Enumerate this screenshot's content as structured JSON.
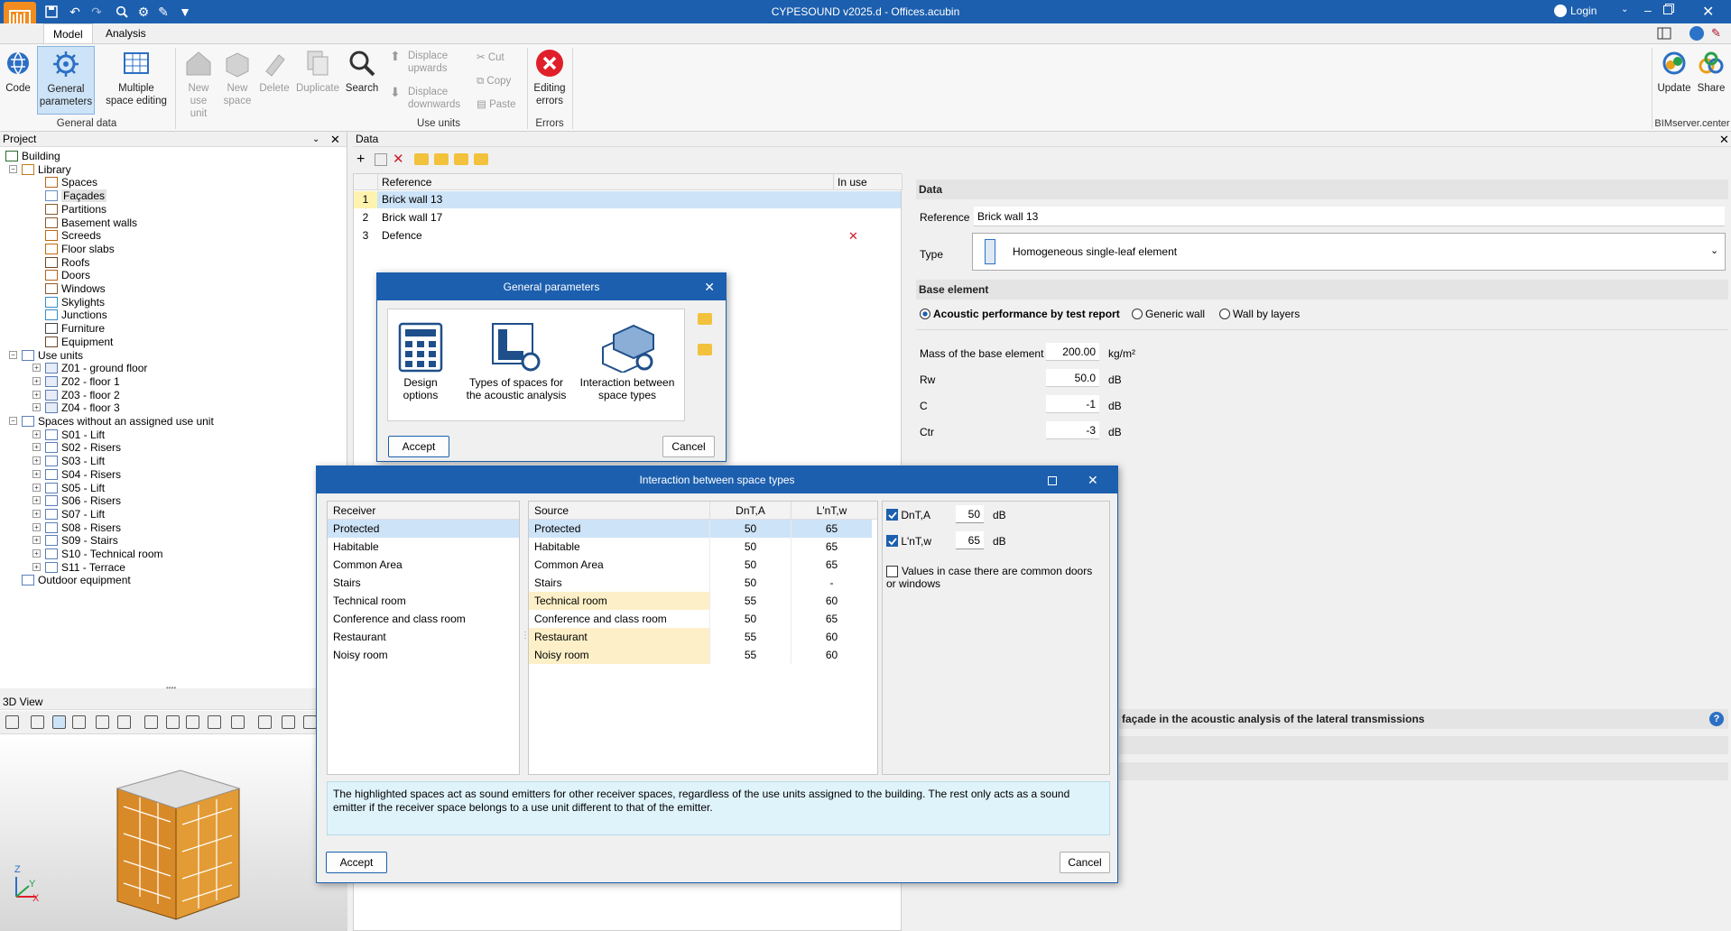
{
  "window": {
    "title": "CYPESOUND v2025.d - Offices.acubin",
    "login": "Login"
  },
  "menu": {
    "tabs": [
      "Model",
      "Analysis"
    ]
  },
  "ribbon": {
    "code": "Code",
    "general_parameters": [
      "General",
      "parameters"
    ],
    "multiple_space_editing": [
      "Multiple",
      "space editing"
    ],
    "group_general_data": "General data",
    "new_use_unit": [
      "New",
      "use unit"
    ],
    "new_space": [
      "New",
      "space"
    ],
    "delete": "Delete",
    "duplicate": "Duplicate",
    "search": "Search",
    "group_use_units": "Use units",
    "displace_upwards": [
      "Displace",
      "upwards"
    ],
    "displace_downwards": [
      "Displace",
      "downwards"
    ],
    "cut": "Cut",
    "copy": "Copy",
    "paste": "Paste",
    "editing_errors": [
      "Editing",
      "errors"
    ],
    "group_errors": "Errors",
    "update": "Update",
    "share": "Share",
    "group_bim": "BIMserver.center"
  },
  "project_panel": {
    "title": "Project",
    "tree": [
      {
        "label": "Building",
        "level": 0
      },
      {
        "label": "Library",
        "level": 1
      },
      {
        "label": "Spaces",
        "level": 2
      },
      {
        "label": "Façades",
        "level": 2
      },
      {
        "label": "Partitions",
        "level": 2
      },
      {
        "label": "Basement walls",
        "level": 2
      },
      {
        "label": "Screeds",
        "level": 2
      },
      {
        "label": "Floor slabs",
        "level": 2
      },
      {
        "label": "Roofs",
        "level": 2
      },
      {
        "label": "Doors",
        "level": 2
      },
      {
        "label": "Windows",
        "level": 2
      },
      {
        "label": "Skylights",
        "level": 2
      },
      {
        "label": "Junctions",
        "level": 2
      },
      {
        "label": "Furniture",
        "level": 2
      },
      {
        "label": "Equipment",
        "level": 2
      },
      {
        "label": "Use units",
        "level": 1
      },
      {
        "label": "Z01 - ground floor",
        "level": 2
      },
      {
        "label": "Z02 - floor 1",
        "level": 2
      },
      {
        "label": "Z03 - floor 2",
        "level": 2
      },
      {
        "label": "Z04 - floor 3",
        "level": 2
      },
      {
        "label": "Spaces without an assigned use unit",
        "level": 1
      },
      {
        "label": "S01 - Lift",
        "level": 2
      },
      {
        "label": "S02 - Risers",
        "level": 2
      },
      {
        "label": "S03 - Lift",
        "level": 2
      },
      {
        "label": "S04 - Risers",
        "level": 2
      },
      {
        "label": "S05 - Lift",
        "level": 2
      },
      {
        "label": "S06 - Risers",
        "level": 2
      },
      {
        "label": "S07 - Lift",
        "level": 2
      },
      {
        "label": "S08 - Risers",
        "level": 2
      },
      {
        "label": "S09 - Stairs",
        "level": 2
      },
      {
        "label": "S10 - Technical room",
        "level": 2
      },
      {
        "label": "S11 - Terrace",
        "level": 2
      },
      {
        "label": "Outdoor equipment",
        "level": 1
      }
    ]
  },
  "view3d": {
    "title": "3D View",
    "axis_x": "X",
    "axis_y": "Y",
    "axis_z": "Z"
  },
  "data_panel": {
    "title": "Data",
    "columns": [
      "Reference",
      "In use"
    ],
    "rows": [
      {
        "num": "1",
        "ref": "Brick wall 13"
      },
      {
        "num": "2",
        "ref": "Brick wall 17"
      },
      {
        "num": "3",
        "ref": "Defence"
      }
    ]
  },
  "form": {
    "section_data": "Data",
    "reference_label": "Reference",
    "reference_value": "Brick wall 13",
    "type_label": "Type",
    "type_value": "Homogeneous single-leaf element",
    "section_base": "Base element",
    "radio_test": "Acoustic performance by test report",
    "radio_generic": "Generic wall",
    "radio_layers": "Wall by layers",
    "mass_label": "Mass of the base element",
    "mass_value": "200.00",
    "mass_unit": "kg/m²",
    "rw_label": "Rw",
    "rw_value": "50.0",
    "rw_unit": "dB",
    "c_label": "C",
    "c_value": "-1",
    "c_unit": "dB",
    "ctr_label": "Ctr",
    "ctr_value": "-3",
    "ctr_unit": "dB",
    "facade_section": "façade in the acoustic analysis of the lateral transmissions"
  },
  "general_params_dialog": {
    "title": "General parameters",
    "items": [
      {
        "label": [
          "Design",
          "options"
        ]
      },
      {
        "label": [
          "Types of spaces for",
          "the acoustic analysis"
        ]
      },
      {
        "label": [
          "Interaction between",
          "space types"
        ]
      }
    ],
    "accept": "Accept",
    "cancel": "Cancel"
  },
  "interaction_dialog": {
    "title": "Interaction between space types",
    "receiver_header": "Receiver",
    "receivers": [
      "Protected",
      "Habitable",
      "Common Area",
      "Stairs",
      "Technical room",
      "Conference and class room",
      "Restaurant",
      "Noisy room"
    ],
    "source_headers": [
      "Source",
      "DnT,A",
      "L'nT,w"
    ],
    "sources": [
      {
        "name": "Protected",
        "dnta": "50",
        "lntw": "65",
        "hl": false
      },
      {
        "name": "Habitable",
        "dnta": "50",
        "lntw": "65",
        "hl": false
      },
      {
        "name": "Common Area",
        "dnta": "50",
        "lntw": "65",
        "hl": false
      },
      {
        "name": "Stairs",
        "dnta": "50",
        "lntw": "-",
        "hl": false
      },
      {
        "name": "Technical room",
        "dnta": "55",
        "lntw": "60",
        "hl": true
      },
      {
        "name": "Conference and class room",
        "dnta": "50",
        "lntw": "65",
        "hl": false
      },
      {
        "name": "Restaurant",
        "dnta": "55",
        "lntw": "60",
        "hl": true
      },
      {
        "name": "Noisy room",
        "dnta": "55",
        "lntw": "60",
        "hl": true
      }
    ],
    "dnta_label": "DnT,A",
    "dnta_value": "50",
    "lntw_label": "L'nT,w",
    "lntw_value": "65",
    "unit": "dB",
    "common_doors": "Values in case there are common doors or windows",
    "note": "The highlighted spaces act as sound emitters for other receiver spaces, regardless of the use units assigned to the building. The rest only acts as a sound emitter if the receiver space belongs to a use unit different to that of the emitter.",
    "accept": "Accept",
    "cancel": "Cancel"
  }
}
